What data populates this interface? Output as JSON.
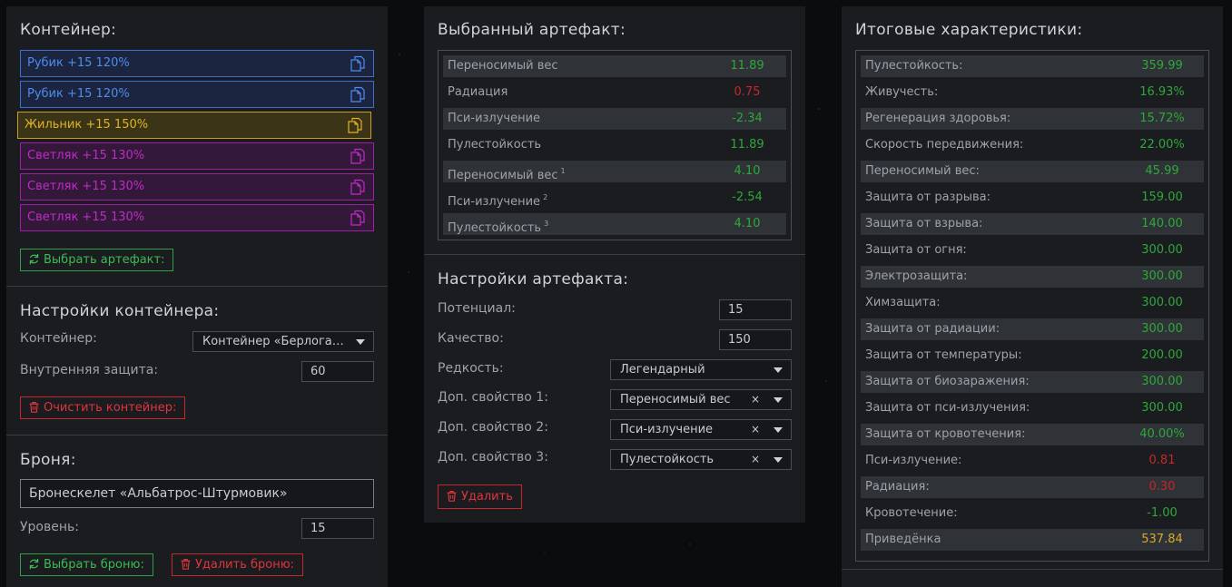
{
  "colors": {
    "blue": "#3b6fd6",
    "yellow": "#c9a214",
    "purple": "#a01ea8",
    "green": "#2ea043",
    "red": "#c9262c",
    "value_positive": "#2fa83a",
    "value_negative": "#c62828",
    "value_gold": "#d6aa2a"
  },
  "container": {
    "title": "Контейнер:",
    "slots": [
      {
        "label": "Рубик +15 120%",
        "color": "blue",
        "icon": "copy-icon"
      },
      {
        "label": "Рубик +15 120%",
        "color": "blue",
        "icon": "copy-icon"
      },
      {
        "label": "Жильник +15 150%",
        "color": "yellow",
        "icon": "copy-icon"
      },
      {
        "label": "Светляк +15 130%",
        "color": "purple",
        "icon": "copy-icon"
      },
      {
        "label": "Светляк +15 130%",
        "color": "purple",
        "icon": "copy-icon"
      },
      {
        "label": "Светляк +15 130%",
        "color": "purple",
        "icon": "copy-icon"
      }
    ],
    "select_button": "Выбрать артефакт:",
    "select_icon": "refresh-icon"
  },
  "container_settings": {
    "title": "Настройки контейнера:",
    "container_label": "Контейнер:",
    "container_value": "Контейнер «Берлога…",
    "protection_label": "Внутренняя защита:",
    "protection_value": "60",
    "clear_button": "Очистить контейнер:",
    "clear_icon": "trash-icon"
  },
  "armor": {
    "title": "Броня:",
    "name_value": "Бронескелет «Альбатрос-Штурмовик»",
    "level_label": "Уровень:",
    "level_value": "15",
    "select_button": "Выбрать броню:",
    "delete_button": "Удалить броню:"
  },
  "selected_artifact": {
    "title": "Выбранный артефакт:",
    "rows": [
      {
        "name": "Переносимый вес",
        "sup": "",
        "value": "11.89",
        "tone": "pos"
      },
      {
        "name": "Радиация",
        "sup": "",
        "value": "0.75",
        "tone": "neg"
      },
      {
        "name": "Пси-излучение",
        "sup": "",
        "value": "-2.34",
        "tone": "pos"
      },
      {
        "name": "Пулестойкость",
        "sup": "",
        "value": "11.89",
        "tone": "pos"
      },
      {
        "name": "Переносимый вес",
        "sup": "1",
        "value": "4.10",
        "tone": "pos"
      },
      {
        "name": "Пси-излучение",
        "sup": "2",
        "value": "-2.54",
        "tone": "pos"
      },
      {
        "name": "Пулестойкость",
        "sup": "3",
        "value": "4.10",
        "tone": "pos"
      }
    ]
  },
  "artifact_settings": {
    "title": "Настройки артефакта:",
    "potential_label": "Потенциал:",
    "potential_value": "15",
    "quality_label": "Качество:",
    "quality_value": "150",
    "rarity_label": "Редкость:",
    "rarity_value": "Легендарный",
    "extra1_label": "Доп. свойство 1:",
    "extra1_value": "Переносимый вес",
    "extra2_label": "Доп. свойство 2:",
    "extra2_value": "Пси-излучение",
    "extra3_label": "Доп. свойство 3:",
    "extra3_value": "Пулестойкость",
    "clear_symbol": "×",
    "delete_button": "Удалить"
  },
  "totals": {
    "title": "Итоговые характеристики:",
    "rows": [
      {
        "name": "Пулестойкость:",
        "value": "359.99",
        "tone": "pos"
      },
      {
        "name": "Живучесть:",
        "value": "16.93%",
        "tone": "pos"
      },
      {
        "name": "Регенерация здоровья:",
        "value": "15.72%",
        "tone": "pos"
      },
      {
        "name": "Скорость передвижения:",
        "value": "22.00%",
        "tone": "pos"
      },
      {
        "name": "Переносимый вес:",
        "value": "45.99",
        "tone": "pos"
      },
      {
        "name": "Защита от разрыва:",
        "value": "159.00",
        "tone": "pos"
      },
      {
        "name": "Защита от взрыва:",
        "value": "140.00",
        "tone": "pos"
      },
      {
        "name": "Защита от огня:",
        "value": "300.00",
        "tone": "pos"
      },
      {
        "name": "Электрозащита:",
        "value": "300.00",
        "tone": "pos"
      },
      {
        "name": "Химзащита:",
        "value": "300.00",
        "tone": "pos"
      },
      {
        "name": "Защита от радиации:",
        "value": "300.00",
        "tone": "pos"
      },
      {
        "name": "Защита от температуры:",
        "value": "200.00",
        "tone": "pos"
      },
      {
        "name": "Защита от биозаражения:",
        "value": "300.00",
        "tone": "pos"
      },
      {
        "name": "Защита от пси-излучения:",
        "value": "300.00",
        "tone": "pos"
      },
      {
        "name": "Защита от кровотечения:",
        "value": "40.00%",
        "tone": "pos"
      },
      {
        "name": "Пси-излучение:",
        "value": "0.81",
        "tone": "neg"
      },
      {
        "name": "Радиация:",
        "value": "0.30",
        "tone": "neg"
      },
      {
        "name": "Кровотечение:",
        "value": "-1.00",
        "tone": "pos"
      },
      {
        "name": "Приведёнка",
        "value": "537.84",
        "tone": "gold"
      }
    ]
  }
}
